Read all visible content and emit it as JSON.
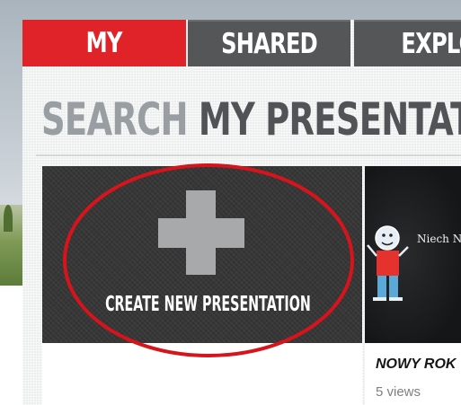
{
  "tabs": [
    {
      "label": "MY",
      "active": true
    },
    {
      "label": "SHARED",
      "active": false
    },
    {
      "label": "EXPLOR",
      "active": false
    }
  ],
  "search": {
    "word": "SEARCH",
    "rest": "MY PRESENTATIONS"
  },
  "create_card": {
    "label": "CREATE NEW PRESENTATION"
  },
  "presentation": {
    "thumb_text": "Niech N",
    "title": "NOWY ROK",
    "views": "5 views"
  },
  "colors": {
    "accent": "#e02328",
    "tab_inactive": "#555657",
    "annotation": "#d7141b"
  }
}
